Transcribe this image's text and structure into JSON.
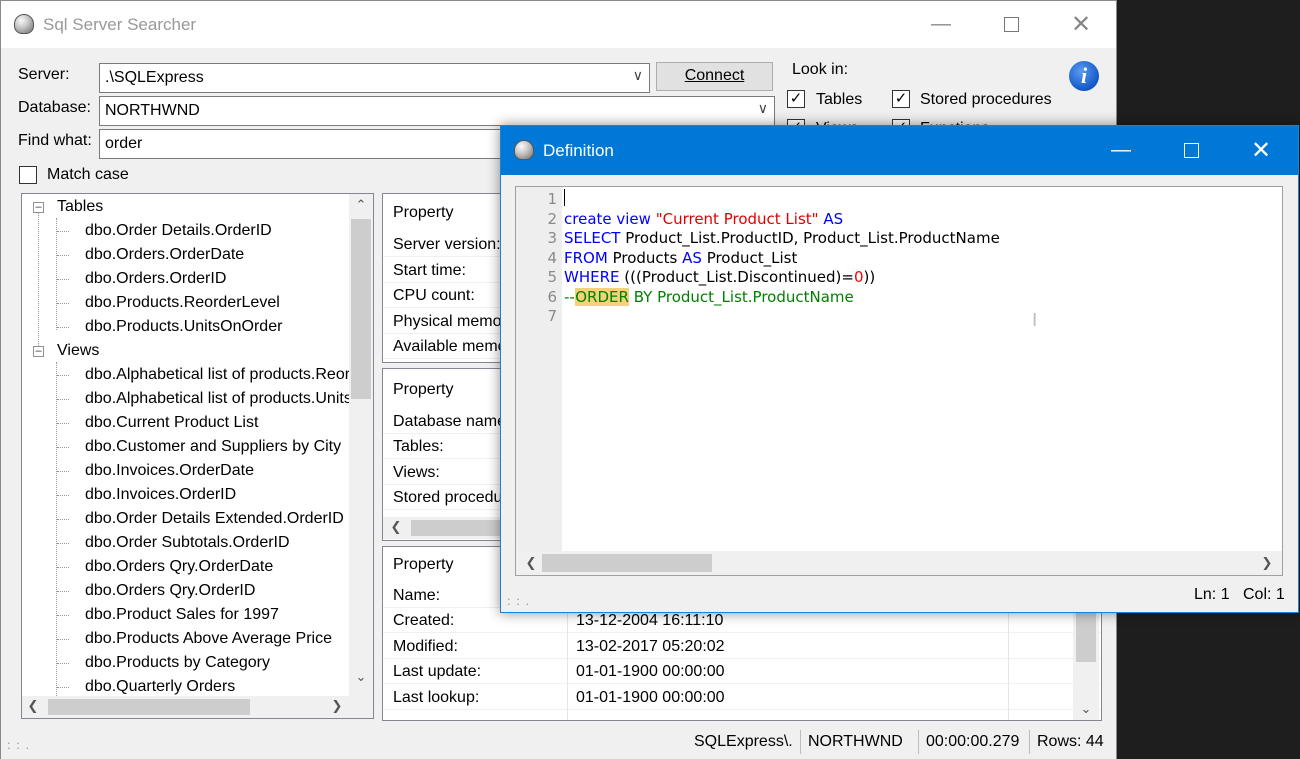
{
  "main": {
    "title": "Sql Server Searcher",
    "labels": {
      "server": "Server:",
      "database": "Database:",
      "find_what": "Find what:"
    },
    "server_value": ".\\SQLExpress",
    "database_value": "NORTHWND",
    "find_value": "order",
    "connect_label": "Connect",
    "match_case": {
      "label": "Match case",
      "checked": false
    },
    "look_in": {
      "label": "Look in:",
      "tables": {
        "label": "Tables",
        "checked": true
      },
      "stored_procedures": {
        "label": "Stored procedures",
        "checked": true
      },
      "views": {
        "label": "Views",
        "checked": true
      },
      "functions": {
        "label": "Functions",
        "checked": true
      }
    }
  },
  "tree": {
    "tables_label": "Tables",
    "tables": [
      "dbo.Order Details.OrderID",
      "dbo.Orders.OrderDate",
      "dbo.Orders.OrderID",
      "dbo.Products.ReorderLevel",
      "dbo.Products.UnitsOnOrder"
    ],
    "views_label": "Views",
    "views": [
      "dbo.Alphabetical list of products.ReorderLevel",
      "dbo.Alphabetical list of products.UnitsOnOrder",
      "dbo.Current Product List",
      "dbo.Customer and Suppliers by City",
      "dbo.Invoices.OrderDate",
      "dbo.Invoices.OrderID",
      "dbo.Order Details Extended.OrderID",
      "dbo.Order Subtotals.OrderID",
      "dbo.Orders Qry.OrderDate",
      "dbo.Orders Qry.OrderID",
      "dbo.Product Sales for 1997",
      "dbo.Products Above Average Price",
      "dbo.Products by Category",
      "dbo.Quarterly Orders"
    ]
  },
  "server_panel": {
    "header": "Property",
    "rows": [
      "Server version:",
      "Start time:",
      "CPU count:",
      "Physical memory:",
      "Available memory:"
    ]
  },
  "db_panel": {
    "header": "Property",
    "rows": [
      "Database name:",
      "Tables:",
      "Views:",
      "Stored procedures:"
    ]
  },
  "obj_panel": {
    "header": "Property",
    "rows": [
      {
        "label": "Name:",
        "value": ""
      },
      {
        "label": "Created:",
        "value": "13-12-2004 16:11:10"
      },
      {
        "label": "Modified:",
        "value": "13-02-2017 05:20:02"
      },
      {
        "label": "Last update:",
        "value": "01-01-1900 00:00:00"
      },
      {
        "label": "Last lookup:",
        "value": "01-01-1900 00:00:00"
      }
    ]
  },
  "status": {
    "server": "SQLExpress\\.",
    "database": "NORTHWND",
    "elapsed": "00:00:00.279",
    "rows": "Rows: 44"
  },
  "definition": {
    "title": "Definition",
    "line_numbers": [
      "1",
      "2",
      "3",
      "4",
      "5",
      "6",
      "7"
    ],
    "code": {
      "l2_kw1": "create view ",
      "l2_str": "\"Current Product List\"",
      "l2_kw2": " AS",
      "l3_kw": "SELECT",
      "l3_rest": " Product_List.ProductID, Product_List.ProductName",
      "l4_kw1": "FROM",
      "l4_mid": " Products ",
      "l4_kw2": "AS",
      "l4_rest": " Product_List",
      "l5_kw": "WHERE",
      "l5_mid": " (((Product_List.Discontinued)=",
      "l5_num": "0",
      "l5_end": "))",
      "l6_prefix": "--",
      "l6_hl": "ORDER",
      "l6_rest": " BY Product_List.ProductName"
    },
    "status_ln": "Ln: 1",
    "status_col": "Col: 1"
  },
  "colors": {
    "keyword": "#0000ff",
    "string": "#e00000",
    "comment": "#008000",
    "highlight": "#f5d27a",
    "active_title": "#0078d7"
  },
  "icons": [
    "app-icon",
    "info-icon",
    "minimize-icon",
    "maximize-icon",
    "close-icon",
    "chevron-down-icon",
    "checkmark-icon",
    "scroll-arrow-icon",
    "text-cursor-icon",
    "resize-grip-icon"
  ]
}
